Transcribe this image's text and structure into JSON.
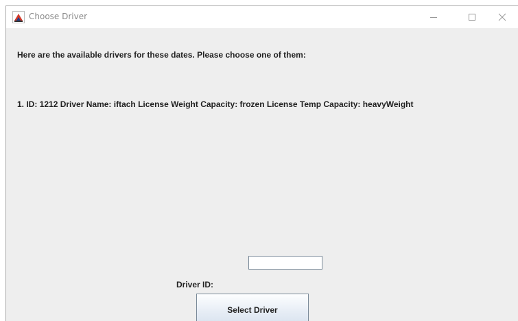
{
  "window": {
    "title": "Choose Driver"
  },
  "content": {
    "intro_text": "Here are the available drivers for these dates. Please choose one of them:",
    "drivers": [
      {
        "line": "1. ID: 1212   Driver Name: iftach   License Weight Capacity: frozen   License Temp Capacity: heavyWeight"
      }
    ],
    "driver_id_label": "Driver ID:",
    "driver_id_value": "",
    "select_button_label": "Select Driver"
  },
  "icons": {
    "app": "java-cup-icon",
    "minimize": "minimize-icon",
    "maximize": "maximize-icon",
    "close": "close-icon"
  },
  "colors": {
    "panel_background": "#eeeeee",
    "button_gradient_top": "#fdfeff",
    "button_gradient_bottom": "#d9e3ef",
    "border": "#7a8a99"
  }
}
